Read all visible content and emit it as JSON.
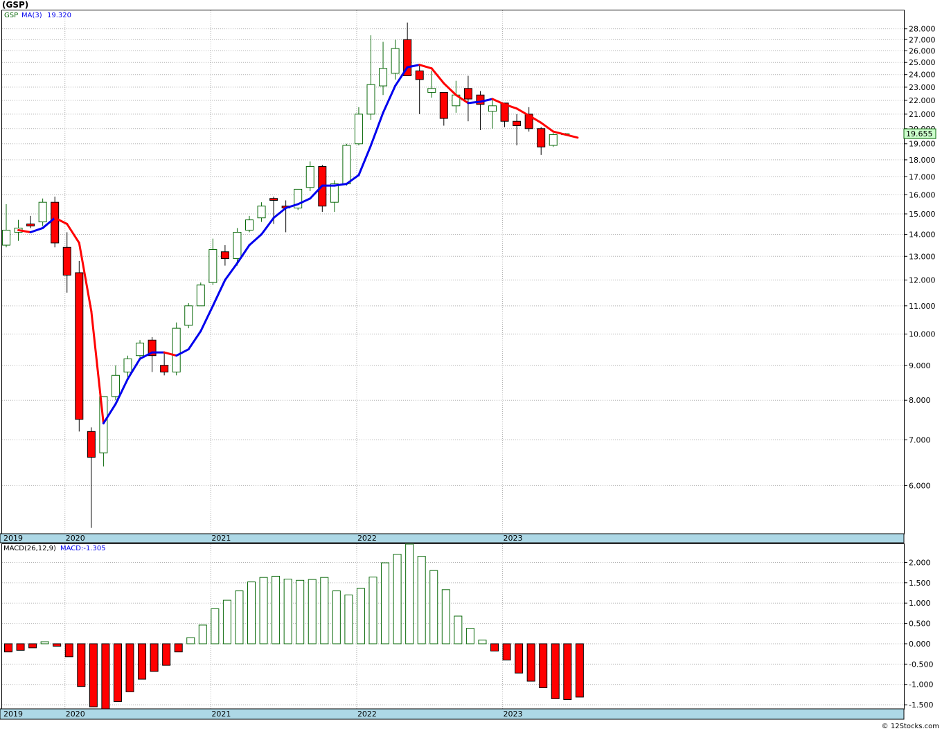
{
  "header": {
    "title": "(GSP)",
    "credit": "© 12Stocks.com"
  },
  "colors": {
    "up": "#0b6a0b",
    "down": "#ff0000",
    "ma_up": "#0000ee",
    "ma_down": "#ff0000",
    "axis_band": "#add8e6",
    "grid": "#aaaaaa",
    "last_price_bg": "#ccffcc"
  },
  "chart_data": [
    {
      "type": "candlestick",
      "scale": "log",
      "legend": {
        "symbol": "GSP",
        "ma_label": "MA(3)",
        "ma_value": "19.320"
      },
      "last_price_label": "19.655",
      "ylim": [
        5.1,
        29.8
      ],
      "y_ticks": [
        "6.000",
        "7.000",
        "8.000",
        "9.000",
        "10.000",
        "11.000",
        "12.000",
        "13.000",
        "14.000",
        "15.000",
        "16.000",
        "17.000",
        "18.000",
        "19.000",
        "20.000",
        "21.000",
        "22.000",
        "23.000",
        "24.000",
        "25.000",
        "26.000",
        "27.000",
        "28.000"
      ],
      "x_year_labels": [
        "2019",
        "2020",
        "2021",
        "2022",
        "2023"
      ],
      "candles": [
        {
          "d": "2019-08",
          "o": 13.5,
          "h": 15.5,
          "l": 13.4,
          "c": 14.2
        },
        {
          "d": "2019-09",
          "o": 14.1,
          "h": 14.7,
          "l": 13.7,
          "c": 14.3
        },
        {
          "d": "2019-10",
          "o": 14.5,
          "h": 14.9,
          "l": 14.3,
          "c": 14.4
        },
        {
          "d": "2019-11",
          "o": 14.6,
          "h": 15.8,
          "l": 14.4,
          "c": 15.6
        },
        {
          "d": "2019-12",
          "o": 15.6,
          "h": 15.9,
          "l": 13.4,
          "c": 13.6
        },
        {
          "d": "2020-01",
          "o": 13.4,
          "h": 14.1,
          "l": 11.5,
          "c": 12.2
        },
        {
          "d": "2020-02",
          "o": 12.3,
          "h": 12.8,
          "l": 7.2,
          "c": 7.5
        },
        {
          "d": "2020-03",
          "o": 7.2,
          "h": 7.3,
          "l": 5.2,
          "c": 6.6
        },
        {
          "d": "2020-04",
          "o": 6.7,
          "h": 8.1,
          "l": 6.4,
          "c": 8.1
        },
        {
          "d": "2020-05",
          "o": 8.1,
          "h": 9.0,
          "l": 8.0,
          "c": 8.7
        },
        {
          "d": "2020-06",
          "o": 8.8,
          "h": 9.3,
          "l": 8.6,
          "c": 9.2
        },
        {
          "d": "2020-07",
          "o": 9.3,
          "h": 9.8,
          "l": 9.2,
          "c": 9.7
        },
        {
          "d": "2020-08",
          "o": 9.8,
          "h": 9.9,
          "l": 8.8,
          "c": 9.3
        },
        {
          "d": "2020-09",
          "o": 9.0,
          "h": 9.4,
          "l": 8.7,
          "c": 8.8
        },
        {
          "d": "2020-10",
          "o": 8.8,
          "h": 10.4,
          "l": 8.7,
          "c": 10.2
        },
        {
          "d": "2020-11",
          "o": 10.3,
          "h": 11.1,
          "l": 10.2,
          "c": 11.0
        },
        {
          "d": "2020-12",
          "o": 11.0,
          "h": 11.9,
          "l": 11.0,
          "c": 11.8
        },
        {
          "d": "2021-01",
          "o": 11.9,
          "h": 13.8,
          "l": 11.8,
          "c": 13.3
        },
        {
          "d": "2021-02",
          "o": 13.2,
          "h": 13.5,
          "l": 12.6,
          "c": 12.9
        },
        {
          "d": "2021-03",
          "o": 12.9,
          "h": 14.3,
          "l": 12.6,
          "c": 14.1
        },
        {
          "d": "2021-04",
          "o": 14.2,
          "h": 14.9,
          "l": 14.1,
          "c": 14.7
        },
        {
          "d": "2021-05",
          "o": 14.8,
          "h": 15.6,
          "l": 14.6,
          "c": 15.4
        },
        {
          "d": "2021-06",
          "o": 15.8,
          "h": 15.9,
          "l": 14.5,
          "c": 15.7
        },
        {
          "d": "2021-07",
          "o": 15.4,
          "h": 15.7,
          "l": 14.1,
          "c": 15.3
        },
        {
          "d": "2021-08",
          "o": 15.3,
          "h": 16.3,
          "l": 15.2,
          "c": 16.3
        },
        {
          "d": "2021-09",
          "o": 16.4,
          "h": 17.9,
          "l": 16.2,
          "c": 17.6
        },
        {
          "d": "2021-10",
          "o": 17.6,
          "h": 17.7,
          "l": 15.1,
          "c": 15.4
        },
        {
          "d": "2021-11",
          "o": 15.6,
          "h": 16.8,
          "l": 15.1,
          "c": 16.6
        },
        {
          "d": "2021-12",
          "o": 16.6,
          "h": 19.0,
          "l": 16.5,
          "c": 18.9
        },
        {
          "d": "2022-01",
          "o": 19.0,
          "h": 21.5,
          "l": 18.9,
          "c": 21.0
        },
        {
          "d": "2022-02",
          "o": 21.0,
          "h": 27.4,
          "l": 20.6,
          "c": 23.2
        },
        {
          "d": "2022-03",
          "o": 23.1,
          "h": 26.8,
          "l": 22.4,
          "c": 24.5
        },
        {
          "d": "2022-04",
          "o": 24.1,
          "h": 27.0,
          "l": 23.6,
          "c": 26.2
        },
        {
          "d": "2022-05",
          "o": 27.0,
          "h": 28.6,
          "l": 23.9,
          "c": 23.9
        },
        {
          "d": "2022-06",
          "o": 24.3,
          "h": 24.8,
          "l": 21.0,
          "c": 23.6
        },
        {
          "d": "2022-07",
          "o": 22.6,
          "h": 24.3,
          "l": 22.2,
          "c": 22.9
        },
        {
          "d": "2022-08",
          "o": 22.6,
          "h": 22.6,
          "l": 20.2,
          "c": 20.7
        },
        {
          "d": "2022-09",
          "o": 21.6,
          "h": 23.5,
          "l": 21.1,
          "c": 22.4
        },
        {
          "d": "2022-10",
          "o": 22.9,
          "h": 23.9,
          "l": 20.5,
          "c": 22.1
        },
        {
          "d": "2022-11",
          "o": 22.4,
          "h": 22.7,
          "l": 19.9,
          "c": 21.7
        },
        {
          "d": "2022-12",
          "o": 21.2,
          "h": 22.0,
          "l": 20.0,
          "c": 21.6
        },
        {
          "d": "2023-01",
          "o": 21.8,
          "h": 21.8,
          "l": 20.1,
          "c": 20.5
        },
        {
          "d": "2023-02",
          "o": 20.5,
          "h": 21.0,
          "l": 18.9,
          "c": 20.2
        },
        {
          "d": "2023-03",
          "o": 21.0,
          "h": 21.5,
          "l": 19.8,
          "c": 20.0
        },
        {
          "d": "2023-04",
          "o": 20.0,
          "h": 20.1,
          "l": 18.3,
          "c": 18.8
        },
        {
          "d": "2023-05",
          "o": 18.9,
          "h": 19.7,
          "l": 18.8,
          "c": 19.6
        },
        {
          "d": "2023-06",
          "o": 19.65,
          "h": 19.7,
          "l": 19.6,
          "c": 19.66
        }
      ],
      "ma3": [
        14.2,
        14.1,
        14.3,
        14.8,
        14.5,
        13.6,
        10.8,
        7.4,
        7.9,
        8.6,
        9.2,
        9.4,
        9.4,
        9.3,
        9.5,
        10.1,
        11.0,
        12.0,
        12.7,
        13.5,
        14.0,
        14.8,
        15.3,
        15.5,
        15.8,
        16.5,
        16.5,
        16.6,
        17.1,
        18.9,
        21.1,
        23.1,
        24.6,
        24.8,
        24.5,
        23.3,
        22.4,
        21.8,
        21.9,
        22.1,
        21.7,
        21.4,
        20.9,
        20.4,
        19.8,
        19.6,
        19.4
      ]
    },
    {
      "type": "bar",
      "legend": {
        "label": "MACD(26,12,9)",
        "value_label": "MACD:-1.305"
      },
      "ylim": [
        -1.6,
        2.45
      ],
      "y_ticks": [
        "-1.500",
        "-1.000",
        "-0.500",
        "0.000",
        "0.500",
        "1.000",
        "1.500",
        "2.000"
      ],
      "x_year_labels": [
        "2019",
        "2020",
        "2021",
        "2022",
        "2023"
      ],
      "values": [
        -0.2,
        -0.16,
        -0.1,
        0.05,
        -0.06,
        -0.32,
        -1.05,
        -1.55,
        -1.6,
        -1.42,
        -1.18,
        -0.87,
        -0.68,
        -0.53,
        -0.2,
        0.15,
        0.46,
        0.86,
        1.07,
        1.3,
        1.52,
        1.63,
        1.66,
        1.59,
        1.56,
        1.58,
        1.63,
        1.3,
        1.2,
        1.36,
        1.64,
        1.99,
        2.2,
        2.45,
        2.15,
        1.8,
        1.33,
        0.68,
        0.38,
        0.09,
        -0.18,
        -0.4,
        -0.72,
        -0.92,
        -1.08,
        -1.35,
        -1.37,
        -1.31
      ]
    }
  ]
}
